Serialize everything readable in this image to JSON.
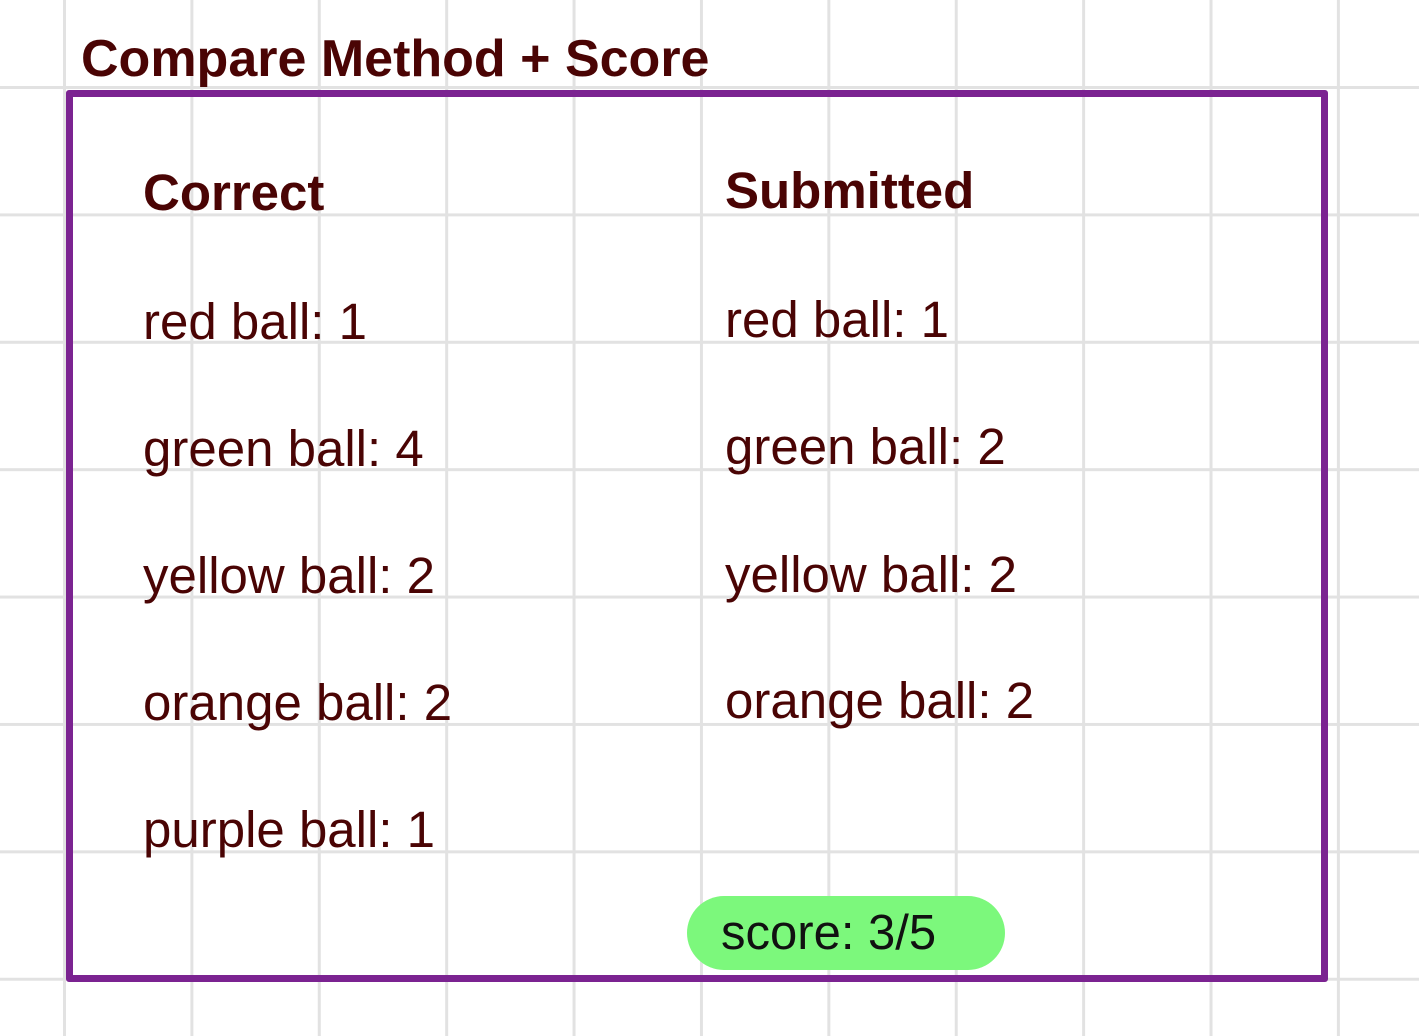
{
  "title": "Compare Method + Score",
  "correct": {
    "header": "Correct",
    "items": [
      "red ball: 1",
      "green ball: 4",
      "yellow ball: 2",
      "orange ball: 2",
      "purple ball: 1"
    ]
  },
  "submitted": {
    "header": "Submitted",
    "items": [
      "red ball: 1",
      "green ball: 2",
      "yellow ball: 2",
      "orange ball: 2"
    ]
  },
  "score": {
    "label": "score: 3/5",
    "correct_count": 3,
    "total": 5
  },
  "colors": {
    "text": "#4a0404",
    "frame": "#7b2391",
    "score_badge": "#7cf87c",
    "grid": "#e2e2e2"
  }
}
